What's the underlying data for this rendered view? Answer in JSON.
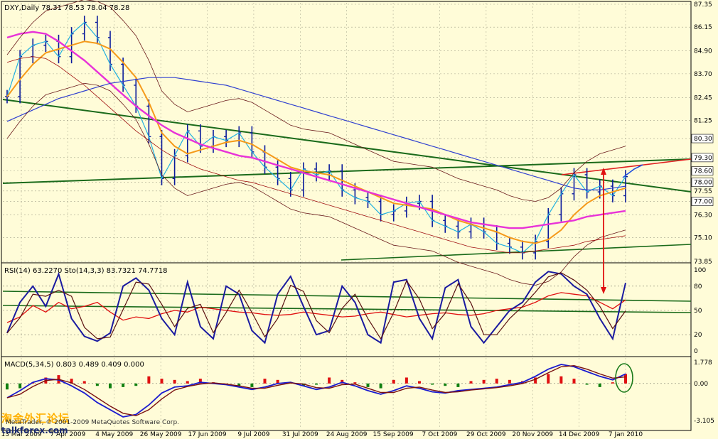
{
  "chart_data": {
    "type": "line",
    "symbol_header": "DXY,Daily  78.31 78.53 78.04 78.28",
    "price_ticks": [
      "87.35",
      "86.15",
      "84.90",
      "83.70",
      "82.45",
      "81.25",
      "80.30",
      "79.30",
      "78.60",
      "78.00",
      "77.55",
      "77.00",
      "76.30",
      "75.10",
      "73.85"
    ],
    "highlighted_levels": [
      "80.30",
      "79.30",
      "78.60",
      "78.00",
      "77.00"
    ],
    "rsi_header": "RSI(14) 63.2270  Sto(14,3,3) 83.7321 74.7718",
    "rsi_ticks": [
      "100",
      "80",
      "50",
      "20",
      "0"
    ],
    "macd_header": "MACD(5,34,5) 0.803 0.489 0.409 0.000",
    "macd_ticks": [
      "1.778",
      "0.00",
      "-3.105"
    ],
    "x_labels": [
      "13 Mar 2009",
      "7 Apr 2009",
      "4 May 2009",
      "26 May 2009",
      "17 Jun 2009",
      "9 Jul 2009",
      "31 Jul 2009",
      "24 Aug 2009",
      "15 Sep 2009",
      "7 Oct 2009",
      "29 Oct 2009",
      "20 Nov 2009",
      "14 Dec 2009",
      "7 Jan 2010"
    ],
    "price_ylim": [
      73.85,
      87.35
    ],
    "rsi_ylim": [
      0,
      100
    ],
    "macd_ylim": [
      -3.105,
      1.778
    ],
    "price_series": [
      82.5,
      84.6,
      85.2,
      85.4,
      84.6,
      85.8,
      86.4,
      85.6,
      84.2,
      83.1,
      82.0,
      80.4,
      78.2,
      79.4,
      80.7,
      79.9,
      80.4,
      80.2,
      80.6,
      79.6,
      78.8,
      78.2,
      77.6,
      78.7,
      78.4,
      78.6,
      77.6,
      77.2,
      77.0,
      76.3,
      76.5,
      76.9,
      77.0,
      76.0,
      75.7,
      75.4,
      75.8,
      75.4,
      74.8,
      74.6,
      74.3,
      74.9,
      76.3,
      77.4,
      78.4,
      77.5,
      77.8,
      77.3,
      78.3
    ],
    "sma_fast": [
      82.5,
      83.4,
      84.2,
      84.8,
      85.0,
      85.2,
      85.4,
      85.3,
      85.0,
      84.3,
      83.5,
      82.2,
      80.6,
      79.9,
      79.5,
      79.7,
      79.9,
      80.1,
      80.2,
      80.0,
      79.6,
      79.2,
      78.8,
      78.6,
      78.5,
      78.4,
      78.1,
      77.8,
      77.5,
      77.2,
      76.9,
      76.8,
      76.7,
      76.6,
      76.3,
      76.0,
      75.8,
      75.6,
      75.4,
      75.1,
      74.9,
      74.8,
      75.0,
      75.5,
      76.3,
      76.9,
      77.3,
      77.5,
      77.7
    ],
    "sma_magenta": [
      85.6,
      85.8,
      85.9,
      85.8,
      85.4,
      84.9,
      84.4,
      83.8,
      83.2,
      82.6,
      82.0,
      81.5,
      81.0,
      80.6,
      80.3,
      80.0,
      79.8,
      79.6,
      79.4,
      79.3,
      79.1,
      78.9,
      78.7,
      78.5,
      78.3,
      78.1,
      77.9,
      77.7,
      77.5,
      77.3,
      77.1,
      76.9,
      76.7,
      76.5,
      76.3,
      76.1,
      75.9,
      75.8,
      75.7,
      75.6,
      75.6,
      75.7,
      75.8,
      75.9,
      76.0,
      76.2,
      76.3,
      76.4,
      76.5
    ],
    "sma_blue": [
      81.2,
      81.5,
      81.8,
      82.1,
      82.4,
      82.6,
      82.8,
      83.0,
      83.2,
      83.3,
      83.4,
      83.5,
      83.5,
      83.5,
      83.4,
      83.3,
      83.2,
      83.1,
      82.9,
      82.7,
      82.5,
      82.3,
      82.1,
      81.9,
      81.7,
      81.5,
      81.3,
      81.1,
      80.9,
      80.7,
      80.5,
      80.3,
      80.1,
      79.9,
      79.7,
      79.5,
      79.3,
      79.1,
      78.9,
      78.7,
      78.5,
      78.3,
      78.1,
      77.9,
      77.7,
      77.6,
      77.6,
      77.7,
      77.8
    ],
    "rsi_series": [
      35,
      42,
      56,
      48,
      60,
      52,
      55,
      60,
      48,
      38,
      42,
      40,
      46,
      50,
      48,
      54,
      52,
      50,
      48,
      47,
      45,
      44,
      45,
      48,
      46,
      44,
      42,
      43,
      46,
      48,
      45,
      42,
      44,
      46,
      47,
      45,
      44,
      46,
      50,
      52,
      54,
      60,
      68,
      72,
      70,
      68,
      60,
      52,
      63
    ],
    "stoch_k": [
      22,
      60,
      80,
      55,
      95,
      40,
      18,
      12,
      22,
      80,
      90,
      75,
      40,
      20,
      85,
      30,
      15,
      80,
      70,
      25,
      10,
      70,
      92,
      55,
      20,
      25,
      80,
      60,
      20,
      10,
      85,
      88,
      40,
      15,
      78,
      88,
      30,
      10,
      30,
      50,
      60,
      85,
      98,
      95,
      80,
      70,
      40,
      15,
      84
    ],
    "macd_hist": [
      -0.5,
      -0.4,
      0.1,
      0.5,
      0.7,
      0.4,
      0.2,
      -0.2,
      -0.4,
      -0.3,
      -0.2,
      0.6,
      0.4,
      0.3,
      0.2,
      0.4,
      0.1,
      0.0,
      -0.2,
      -0.3,
      0.4,
      0.3,
      0.1,
      -0.2,
      -0.1,
      0.5,
      0.3,
      0.1,
      -0.3,
      -0.4,
      0.3,
      0.5,
      0.2,
      -0.1,
      -0.2,
      -0.3,
      0.2,
      0.3,
      0.4,
      0.3,
      0.2,
      0.5,
      0.8,
      0.6,
      0.4,
      -0.1,
      -0.3,
      0.1,
      0.8
    ],
    "macd_line": [
      -1.2,
      -0.6,
      0.1,
      0.4,
      0.3,
      -0.2,
      -0.8,
      -1.6,
      -2.2,
      -2.8,
      -2.6,
      -1.8,
      -0.8,
      -0.3,
      -0.2,
      0.1,
      0.0,
      -0.1,
      -0.3,
      -0.5,
      -0.3,
      0.0,
      0.1,
      -0.2,
      -0.5,
      -0.3,
      0.1,
      -0.2,
      -0.6,
      -0.9,
      -0.6,
      -0.2,
      -0.4,
      -0.7,
      -0.8,
      -0.6,
      -0.5,
      -0.4,
      -0.3,
      -0.1,
      0.1,
      0.6,
      1.2,
      1.6,
      1.4,
      1.0,
      0.6,
      0.3,
      0.8
    ],
    "annotation_arrow": {
      "from_price": 79.3,
      "to_rsi": 80
    }
  },
  "colors": {
    "background": "#fffcd8",
    "price_bars": "#0a1a9c",
    "sma_fast": "#f59a1a",
    "sma_magenta": "#e832d8",
    "sma_blue": "#3040d0",
    "trendline": "#1a6a1a",
    "rsi": "#e01010",
    "stoch": "#1a1aa0",
    "hist_up": "#e01010",
    "hist_down": "#108010"
  },
  "watermark": {
    "cn": "淘金外汇论坛",
    "en": "talkforex.com"
  },
  "copyright": "MetaTrader, © 2001-2009 MetaQuotes Software Corp."
}
